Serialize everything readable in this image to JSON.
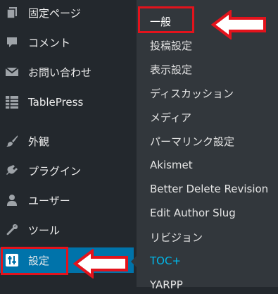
{
  "sidebar": {
    "items": [
      {
        "label": "固定ページ",
        "icon": "pages-icon"
      },
      {
        "label": "コメント",
        "icon": "comment-icon"
      },
      {
        "label": "お問い合わせ",
        "icon": "mail-icon"
      },
      {
        "label": "TablePress",
        "icon": "table-icon"
      },
      {
        "label": "外観",
        "icon": "paintbrush-icon"
      },
      {
        "label": "プラグイン",
        "icon": "plugin-icon"
      },
      {
        "label": "ユーザー",
        "icon": "user-icon"
      },
      {
        "label": "ツール",
        "icon": "wrench-icon"
      },
      {
        "label": "設定",
        "icon": "settings-icon",
        "active": true
      }
    ]
  },
  "submenu": {
    "items": [
      {
        "label": "一般",
        "current": true
      },
      {
        "label": "投稿設定"
      },
      {
        "label": "表示設定"
      },
      {
        "label": "ディスカッション"
      },
      {
        "label": "メディア"
      },
      {
        "label": "パーマリンク設定"
      },
      {
        "label": "Akismet"
      },
      {
        "label": "Better Delete Revision"
      },
      {
        "label": "Edit Author Slug"
      },
      {
        "label": "リビジョン"
      },
      {
        "label": "TOC+",
        "highlight": true
      },
      {
        "label": "YARPP"
      }
    ]
  },
  "colors": {
    "sidebar_bg": "#23282d",
    "submenu_bg": "#32373c",
    "active_bg": "#0073aa",
    "highlight_text": "#00b9eb",
    "annotation_red": "#e3131c"
  }
}
